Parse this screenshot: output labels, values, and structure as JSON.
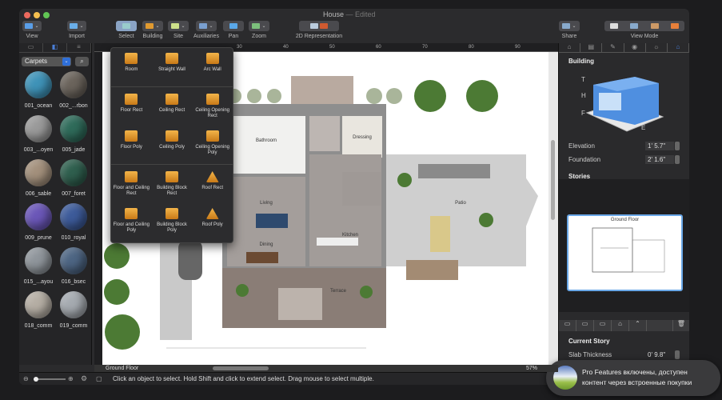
{
  "window": {
    "title": "House",
    "status": "— Edited"
  },
  "toolbar": {
    "items": [
      {
        "label": "View",
        "icon": "view-icon"
      },
      {
        "label": "Import",
        "icon": "import-icon"
      },
      {
        "label": "Select",
        "icon": "select-icon"
      },
      {
        "label": "Building",
        "icon": "building-icon"
      },
      {
        "label": "Site",
        "icon": "site-icon"
      },
      {
        "label": "Auxiliaries",
        "icon": "auxiliaries-icon"
      },
      {
        "label": "Pan",
        "icon": "pan-icon"
      },
      {
        "label": "Zoom",
        "icon": "zoom-icon"
      },
      {
        "label": "2D Representation",
        "icon": "2d-representation-icon"
      },
      {
        "label": "Share",
        "icon": "share-icon"
      },
      {
        "label": "View Mode",
        "icon": "view-mode-icon"
      }
    ]
  },
  "library": {
    "category": "Carpets",
    "materials": [
      {
        "name": "001_ocean",
        "color": "#3f93b8"
      },
      {
        "name": "002_...rbon",
        "color": "#6b645c"
      },
      {
        "name": "003_...oyen",
        "color": "#9a9a9a"
      },
      {
        "name": "005_jade",
        "color": "#2f6b5a"
      },
      {
        "name": "006_sable",
        "color": "#a3907c"
      },
      {
        "name": "007_foret",
        "color": "#2f5f4e"
      },
      {
        "name": "009_prune",
        "color": "#6b57b8"
      },
      {
        "name": "010_royal",
        "color": "#3d5b9a"
      },
      {
        "name": "015_...ayou",
        "color": "#8f959b"
      },
      {
        "name": "016_bsec",
        "color": "#4d6583"
      },
      {
        "name": "018_comm",
        "color": "#b5aea4"
      },
      {
        "name": "019_comm",
        "color": "#a5aab0"
      }
    ]
  },
  "building_menu": {
    "items": [
      "Room",
      "Straight Wall",
      "Arc Wall",
      "Floor Rect",
      "Ceiling Rect",
      "Ceiling Opening Rect",
      "Floor Poly",
      "Ceiling Poly",
      "Ceiling Opening Poly",
      "Floor and Ceiling Rect",
      "Building Block Rect",
      "Roof Rect",
      "Floor and Ceiling Poly",
      "Building Block Poly",
      "Roof Poly"
    ]
  },
  "ruler": {
    "ticks": [
      "30",
      "40",
      "50",
      "60",
      "70",
      "80",
      "90"
    ]
  },
  "plan": {
    "rooms": [
      "Bathroom",
      "Dressing",
      "Living",
      "Kitchen",
      "Dining",
      "Patio",
      "Terrace"
    ]
  },
  "inspector": {
    "section": "Building",
    "diagram_labels": [
      "T",
      "H",
      "F",
      "E"
    ],
    "elevation_label": "Elevation",
    "elevation": "1' 5.7\"",
    "foundation_label": "Foundation",
    "foundation": "2' 1.6\"",
    "stories_label": "Stories",
    "story_name": "Ground Floor",
    "current_story": "Current Story",
    "slab_label": "Slab Thickness",
    "slab": "0' 9.8\""
  },
  "canvas": {
    "floor": "Ground Floor",
    "zoom": "57%"
  },
  "statusbar": {
    "hint": "Click an object to select. Hold Shift and click to extend select. Drag mouse to select multiple."
  },
  "toast": {
    "line1": "Pro Features включены, доступен",
    "line2": "контент через встроенные покупки"
  }
}
